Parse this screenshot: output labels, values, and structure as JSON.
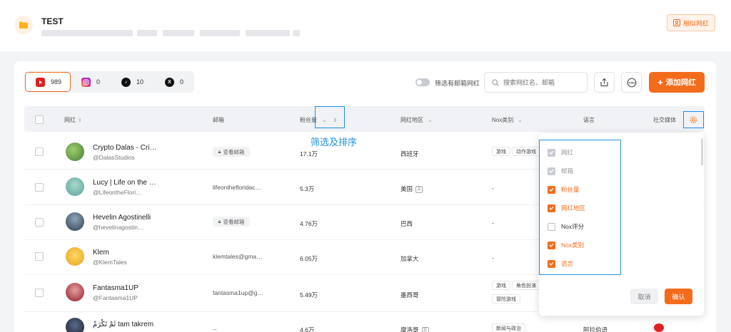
{
  "header": {
    "title": "TEST",
    "similar_button": "相似网红"
  },
  "platforms": [
    {
      "name": "youtube",
      "count": "989",
      "color": "#e02020"
    },
    {
      "name": "instagram",
      "count": "0",
      "color": "#d6249f"
    },
    {
      "name": "tiktok",
      "count": "10",
      "color": "#111111"
    },
    {
      "name": "x",
      "count": "0",
      "color": "#111111"
    }
  ],
  "toolbar": {
    "filter_email_label": "筛选有邮箱网红",
    "search_placeholder": "搜索网红名、邮箱",
    "add_button": "添加网红"
  },
  "table": {
    "headers": {
      "influencer": "网红",
      "email": "邮箱",
      "followers": "粉丝量",
      "region": "网红地区",
      "nox_category": "Nox类别",
      "language": "语言",
      "social": "社交媒体"
    },
    "rows": [
      {
        "name": "Crypto Dalas - Cri…",
        "handle": "@DalasStudios",
        "email": "",
        "email_hidden": "查看邮箱",
        "followers": "17.1万",
        "region": "西班牙",
        "tags": [
          "游戏",
          "动作游戏"
        ],
        "avatar_color": "#4c7a3c"
      },
      {
        "name": "Lucy | Life on the …",
        "handle": "@LifeontheFlori…",
        "email": "lifeonthefloridac…",
        "email_hidden": "",
        "followers": "5.3万",
        "region": "美国",
        "tags": [],
        "nox": "-",
        "avatar_color": "#5ba3a0"
      },
      {
        "name": "Hevelin Agostinelli",
        "handle": "@hevelinagostin…",
        "email": "",
        "email_hidden": "查看邮箱",
        "followers": "4.76万",
        "region": "巴西",
        "tags": [],
        "nox": "-",
        "avatar_color": "#3c5a78"
      },
      {
        "name": "Klem",
        "handle": "@KlemTales",
        "email": "klemtales@gma…",
        "email_hidden": "",
        "followers": "6.05万",
        "region": "加拿大",
        "tags": [],
        "nox": "-",
        "avatar_color": "#e6a51e"
      },
      {
        "name": "Fantasma1UP",
        "handle": "@Fantasma1UP",
        "email": "fantasma1up@g…",
        "email_hidden": "",
        "followers": "5.49万",
        "region": "墨西哥",
        "tags": [
          "游戏",
          "角色扮演",
          "冒险游戏"
        ],
        "avatar_color": "#b4283c"
      },
      {
        "name": "ثَمْ تَكْرَمْ tam takrem",
        "handle": "",
        "email": "--",
        "email_hidden": "",
        "followers": "4.6万",
        "region": "摩洛哥",
        "tags": [
          "新闻与政治"
        ],
        "language": "阿拉伯语",
        "avatar_color": "#2a3040"
      }
    ]
  },
  "annotation": "筛选及排序",
  "settings_panel": {
    "options": [
      {
        "label": "网红",
        "state": "disabled"
      },
      {
        "label": "邮箱",
        "state": "disabled"
      },
      {
        "label": "粉丝量",
        "state": "checked"
      },
      {
        "label": "网红地区",
        "state": "checked"
      },
      {
        "label": "Nox评分",
        "state": "unchecked"
      },
      {
        "label": "Nox类别",
        "state": "checked"
      },
      {
        "label": "语言",
        "state": "checked"
      }
    ],
    "cancel": "取消",
    "confirm": "确认"
  },
  "colors": {
    "accent": "#f36c1c",
    "highlight": "#1e90e6"
  }
}
